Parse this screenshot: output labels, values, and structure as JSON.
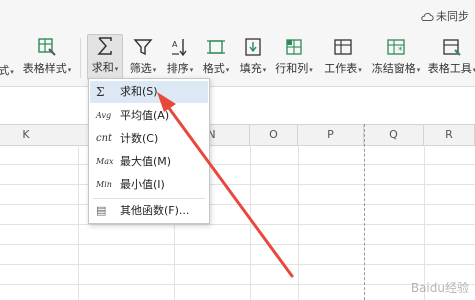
{
  "top_right": {
    "label": "未同步"
  },
  "ribbon": {
    "tools": [
      {
        "id": "partial-left",
        "label": "式"
      },
      {
        "id": "table-style",
        "label": "表格样式"
      },
      {
        "id": "sum",
        "label": "求和"
      },
      {
        "id": "filter",
        "label": "筛选"
      },
      {
        "id": "sort",
        "label": "排序"
      },
      {
        "id": "format",
        "label": "格式"
      },
      {
        "id": "fill",
        "label": "填充"
      },
      {
        "id": "row-col",
        "label": "行和列"
      },
      {
        "id": "worksheet",
        "label": "工作表"
      },
      {
        "id": "freeze",
        "label": "冻结窗格"
      },
      {
        "id": "table-tools",
        "label": "表格工具"
      }
    ]
  },
  "columns": [
    "K",
    "N",
    "O",
    "P",
    "Q",
    "R"
  ],
  "sum_menu": {
    "items": [
      {
        "icon": "Σ",
        "label": "求和(S)"
      },
      {
        "icon": "Avg",
        "label": "平均值(A)"
      },
      {
        "icon": "cnt",
        "label": "计数(C)"
      },
      {
        "icon": "Max",
        "label": "最大值(M)"
      },
      {
        "icon": "Min",
        "label": "最小值(I)"
      },
      {
        "icon": "▤",
        "label": "其他函数(F)..."
      }
    ]
  },
  "watermark": "Baidu经验",
  "colors": {
    "arrow": "#e8473c",
    "highlight": "#dde8f5"
  }
}
